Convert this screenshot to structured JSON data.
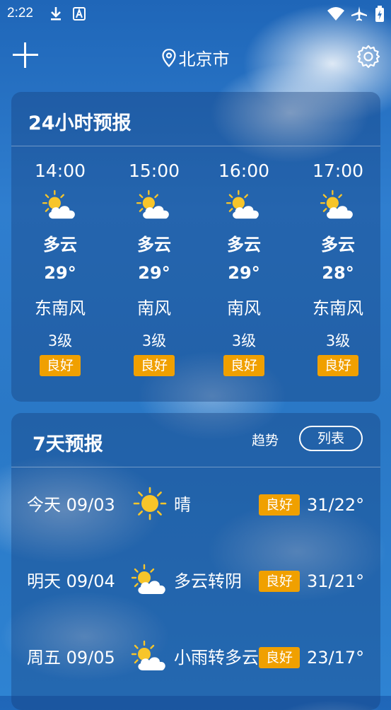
{
  "status": {
    "time": "2:22",
    "icons": [
      "download-icon",
      "a-icon",
      "wifi-icon",
      "airplane-icon",
      "battery-icon"
    ]
  },
  "header": {
    "city": "北京市",
    "add_icon": "plus-icon",
    "location_icon": "location-pin-icon",
    "settings_icon": "gear-icon"
  },
  "hourly": {
    "title": "24小时预报",
    "items": [
      {
        "time": "14:00",
        "icon": "partly-cloudy-icon",
        "weather": "多云",
        "temp": "29°",
        "wind": "东南风",
        "level": "3级",
        "aqi": "良好"
      },
      {
        "time": "15:00",
        "icon": "partly-cloudy-icon",
        "weather": "多云",
        "temp": "29°",
        "wind": "南风",
        "level": "3级",
        "aqi": "良好"
      },
      {
        "time": "16:00",
        "icon": "partly-cloudy-icon",
        "weather": "多云",
        "temp": "29°",
        "wind": "南风",
        "level": "3级",
        "aqi": "良好"
      },
      {
        "time": "17:00",
        "icon": "partly-cloudy-icon",
        "weather": "多云",
        "temp": "28°",
        "wind": "东南风",
        "level": "3级",
        "aqi": "良好"
      }
    ]
  },
  "daily": {
    "title": "7天预报",
    "trend_label": "趋势",
    "list_label": "列表",
    "items": [
      {
        "day": "今天 09/03",
        "icon": "sun-icon",
        "weather": "晴",
        "aqi": "良好",
        "temps": "31/22°"
      },
      {
        "day": "明天 09/04",
        "icon": "partly-cloudy-icon",
        "weather": "多云转阴",
        "aqi": "良好",
        "temps": "31/21°"
      },
      {
        "day": "周五 09/05",
        "icon": "partly-cloudy-icon",
        "weather": "小雨转多云",
        "aqi": "良好",
        "temps": "23/17°"
      }
    ]
  },
  "colors": {
    "accent_badge": "#f0a000",
    "sun": "#f7c52a",
    "card": "rgba(20,60,120,0.38)"
  }
}
